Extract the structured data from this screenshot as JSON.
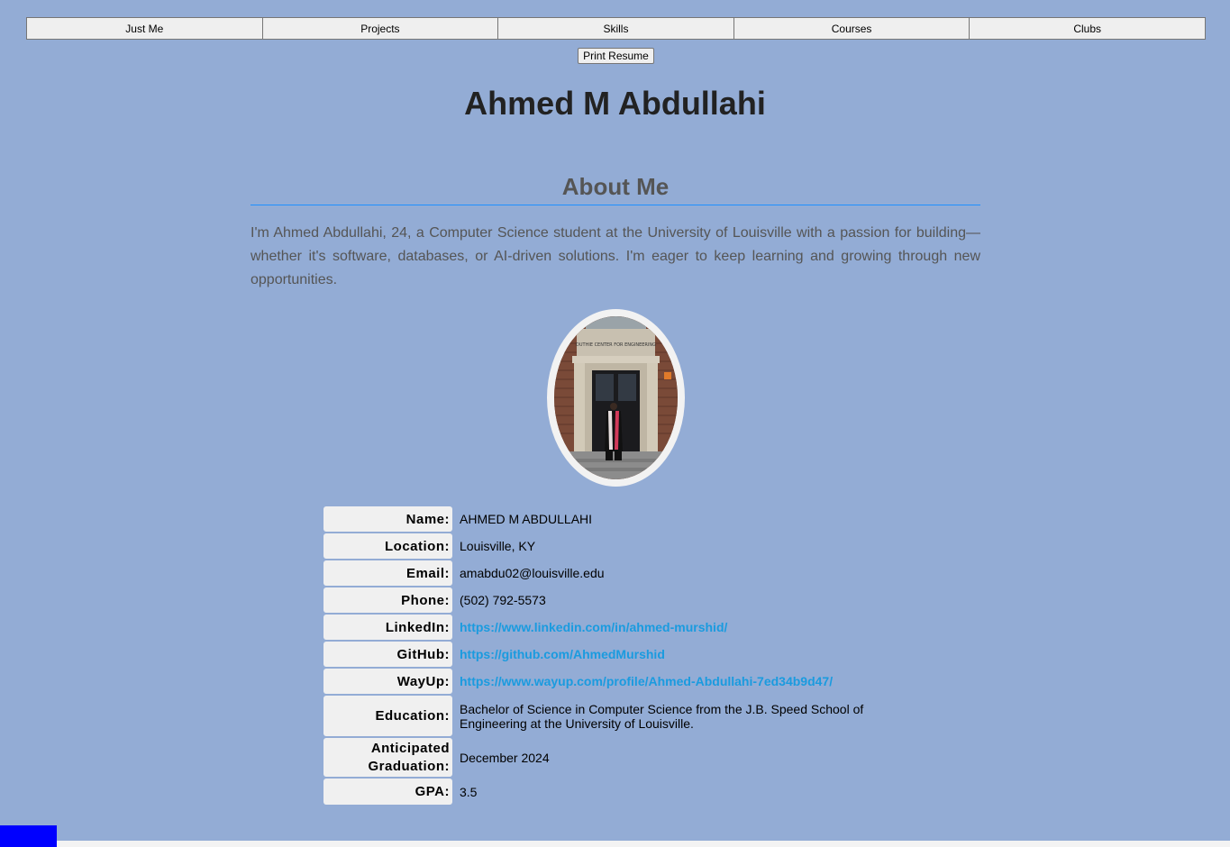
{
  "nav": {
    "items": [
      "Just Me",
      "Projects",
      "Skills",
      "Courses",
      "Clubs"
    ]
  },
  "print_button": "Print Resume",
  "name_title": "Ahmed M Abdullahi",
  "about": {
    "title": "About Me",
    "text": "I'm Ahmed Abdullahi, 24, a Computer Science student at the University of Louisville with a passion for building—whether it's software, databases, or AI-driven solutions. I'm eager to keep learning and growing through new opportunities."
  },
  "photo": {
    "building_sign": "DUTHIE CENTER FOR ENGINEERING"
  },
  "info": {
    "name": {
      "label": "Name:",
      "value": "AHMED M ABDULLAHI"
    },
    "location": {
      "label": "Location:",
      "value": "Louisville, KY"
    },
    "email": {
      "label": "Email:",
      "value": "amabdu02@louisville.edu"
    },
    "phone": {
      "label": "Phone:",
      "value": "(502) 792-5573"
    },
    "linkedin": {
      "label": "LinkedIn:",
      "value": "https://www.linkedin.com/in/ahmed-murshid/"
    },
    "github": {
      "label": "GitHub:",
      "value": "https://github.com/AhmedMurshid"
    },
    "wayup": {
      "label": "WayUp:",
      "value": "https://www.wayup.com/profile/Ahmed-Abdullahi-7ed34b9d47/"
    },
    "education": {
      "label": "Education:",
      "value": "Bachelor of Science in Computer Science from the J.B. Speed School of Engineering at the University of Louisville."
    },
    "graduation": {
      "label_line1": "Anticipated",
      "label_line2": "Graduation:",
      "value": "December 2024"
    },
    "gpa": {
      "label": "GPA:",
      "value": "3.5"
    }
  },
  "colors": {
    "background": "#93acd5",
    "link": "#1a9bdf",
    "divider": "#1e90ff",
    "corner_block": "#0000ff"
  }
}
